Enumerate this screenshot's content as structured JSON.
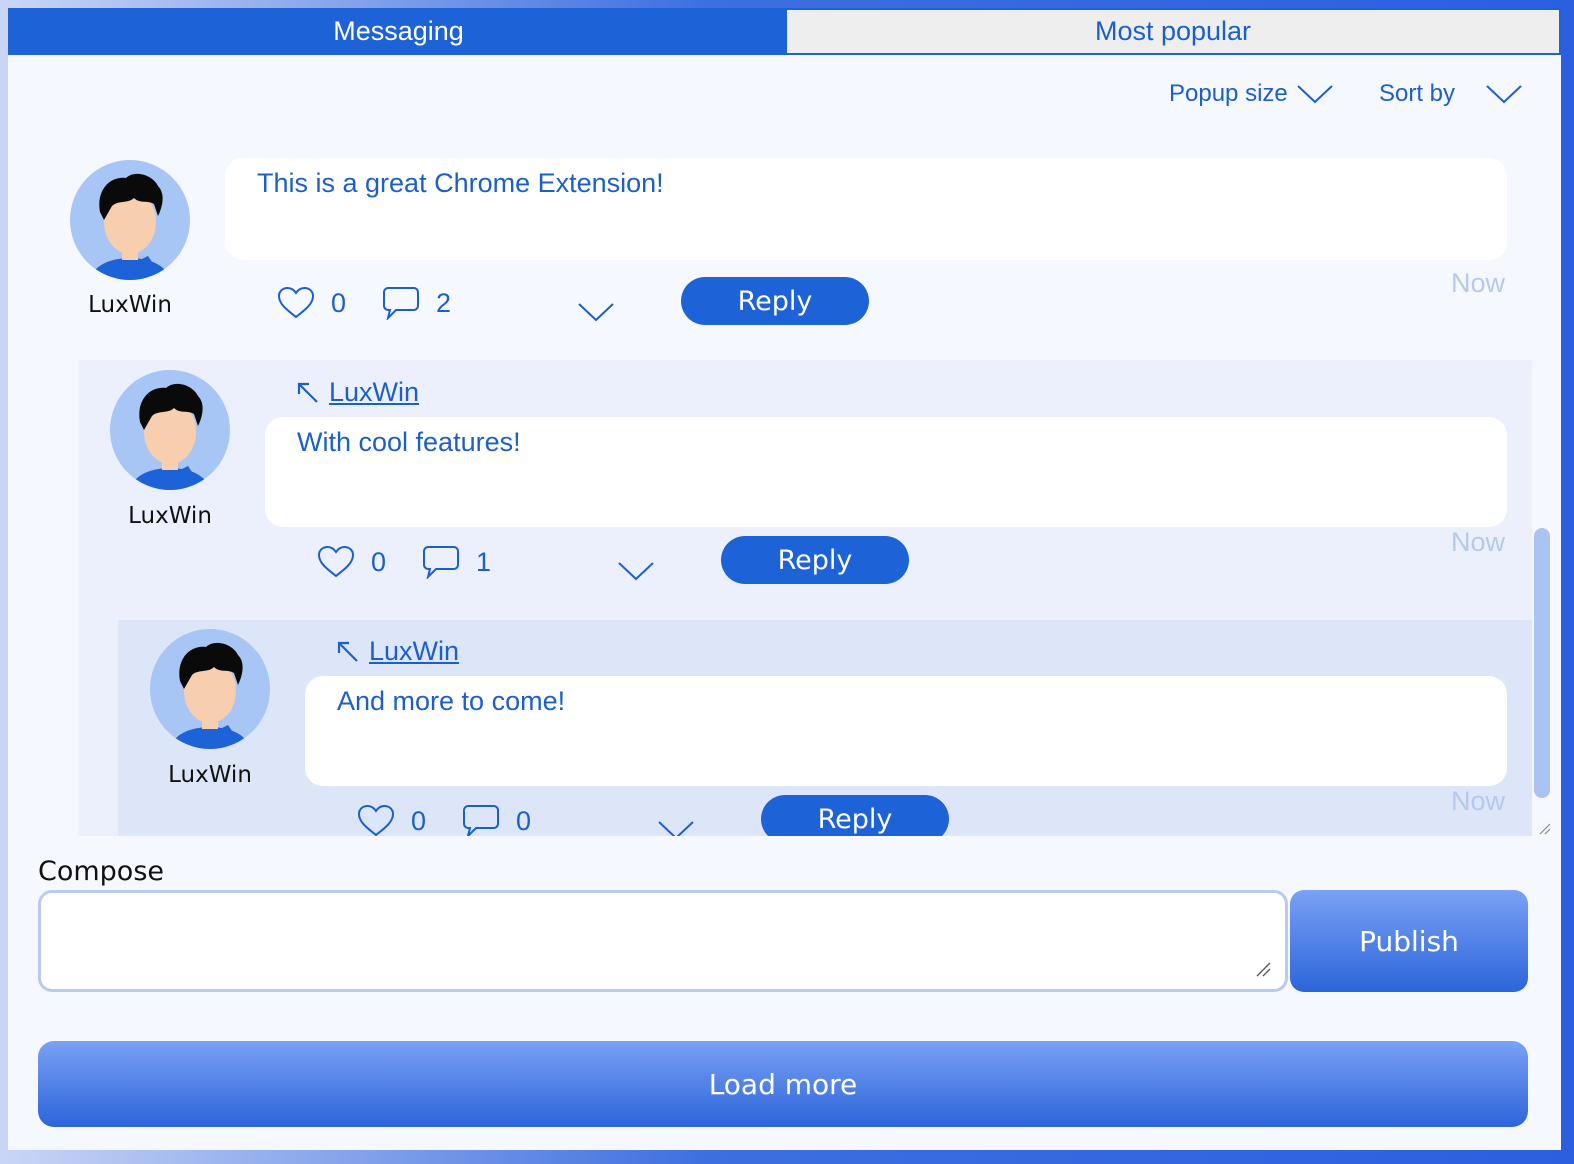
{
  "tabs": {
    "messaging": "Messaging",
    "most_popular": "Most popular"
  },
  "controls": {
    "popup_size": "Popup size",
    "sort_by": "Sort by",
    "chevron_icon": "chevron-down-icon"
  },
  "messages": [
    {
      "author": "LuxWin",
      "text": "This is a great Chrome Extension!",
      "likes": "0",
      "comments": "2",
      "reply_label": "Reply",
      "time": "Now"
    },
    {
      "author": "LuxWin",
      "reply_to": "LuxWin",
      "text": "With cool features!",
      "likes": "0",
      "comments": "1",
      "reply_label": "Reply",
      "time": "Now"
    },
    {
      "author": "LuxWin",
      "reply_to": "LuxWin",
      "text": "And more to come!",
      "likes": "0",
      "comments": "0",
      "reply_label": "Reply",
      "time": "Now"
    }
  ],
  "compose": {
    "label": "Compose",
    "value": "",
    "publish_label": "Publish"
  },
  "load_more": "Load more",
  "colors": {
    "accent": "#1d62d6",
    "text_blue": "#1d5fc9",
    "time_gray": "#b6c8ec",
    "avatar_bg": "#a7c5f5"
  }
}
